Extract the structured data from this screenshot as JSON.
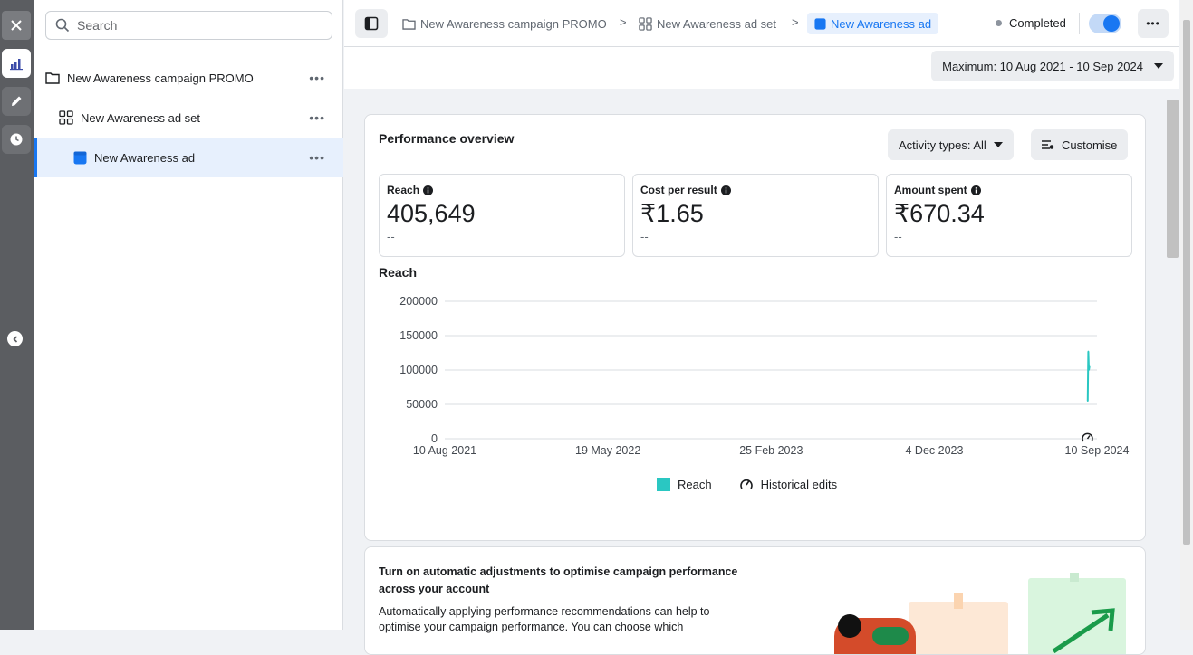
{
  "left_panel": {
    "search_placeholder": "Search",
    "items": [
      {
        "label": "New Awareness campaign PROMO",
        "type": "campaign"
      },
      {
        "label": "New Awareness ad set",
        "type": "adset"
      },
      {
        "label": "New Awareness ad",
        "type": "ad"
      }
    ],
    "more_label": "•••"
  },
  "breadcrumbs": [
    "New Awareness campaign PROMO",
    "New Awareness ad set",
    "New Awareness ad"
  ],
  "status": {
    "label": "Completed",
    "toggle_on": true,
    "toggle_color": "#1877f2"
  },
  "more_label": "•••",
  "date_range": "Maximum: 10 Aug 2021 - 10 Sep 2024",
  "overview": {
    "title": "Performance overview",
    "activity_filter": "Activity types: All",
    "customise": "Customise",
    "metrics": [
      {
        "label": "Reach",
        "value": "405,649",
        "sub": "--"
      },
      {
        "label": "Cost per result",
        "value": "₹1.65",
        "sub": "--"
      },
      {
        "label": "Amount spent",
        "value": "₹670.34",
        "sub": "--"
      }
    ]
  },
  "chart_data": {
    "type": "line",
    "title": "Reach",
    "x_ticks": [
      "10 Aug 2021",
      "19 May 2022",
      "25 Feb 2023",
      "4 Dec 2023",
      "10 Sep 2024"
    ],
    "y_ticks": [
      0,
      50000,
      100000,
      150000,
      200000
    ],
    "ylim": [
      0,
      200000
    ],
    "series": [
      {
        "name": "Reach",
        "color": "#2ac7c2",
        "x": [
          "2024-08-25",
          "2024-08-26",
          "2024-08-27",
          "2024-08-28"
        ],
        "values": [
          55000,
          127000,
          100000,
          105000
        ]
      }
    ],
    "legend": [
      "Reach",
      "Historical edits"
    ],
    "legend_position": "bottom",
    "grid": true
  },
  "recommendation": {
    "title": "Turn on automatic adjustments to optimise campaign performance across your account",
    "body": "Automatically applying performance recommendations can help to optimise your campaign performance. You can choose which"
  },
  "colors": {
    "accent": "#1877f2",
    "rail": "#5b5d61",
    "selected_bg": "#e7f0fd"
  }
}
